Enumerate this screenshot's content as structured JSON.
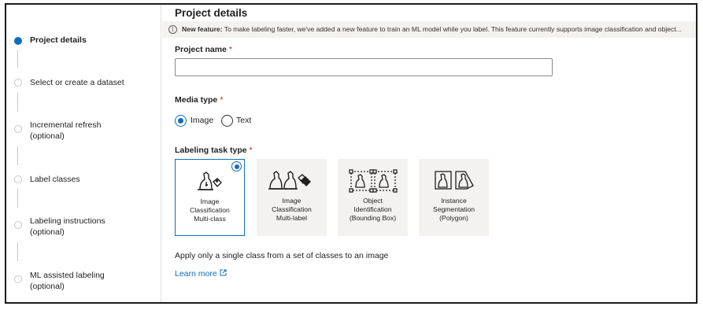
{
  "sidebar": {
    "steps": [
      {
        "label": "Project details",
        "active": true
      },
      {
        "label": "Select or create a dataset",
        "active": false
      },
      {
        "label": "Incremental refresh (optional)",
        "active": false
      },
      {
        "label": "Label classes",
        "active": false
      },
      {
        "label": "Labeling instructions (optional)",
        "active": false
      },
      {
        "label": "ML assisted labeling (optional)",
        "active": false
      }
    ]
  },
  "main": {
    "title": "Project details",
    "banner": {
      "bold": "New feature:",
      "text": " To make labeling faster, we've added a new feature to train an ML model while you label. This feature currently supports image classification and object..."
    },
    "project_name": {
      "label": "Project name",
      "required_mark": "*",
      "value": "",
      "placeholder": ""
    },
    "media_type": {
      "label": "Media type",
      "required_mark": "*",
      "options": [
        {
          "label": "Image",
          "selected": true
        },
        {
          "label": "Text",
          "selected": false
        }
      ]
    },
    "labeling_task": {
      "label": "Labeling task type",
      "required_mark": "*",
      "tiles": [
        {
          "line1": "Image",
          "line2": "Classification",
          "line3": "Multi-class",
          "selected": true,
          "icon": "dog-tag-icon"
        },
        {
          "line1": "Image",
          "line2": "Classification",
          "line3": "Multi-label",
          "selected": false,
          "icon": "two-dogs-tag-icon"
        },
        {
          "line1": "Object",
          "line2": "Identification",
          "line3": "(Bounding Box)",
          "selected": false,
          "icon": "bounding-box-icon"
        },
        {
          "line1": "Instance",
          "line2": "Segmentation",
          "line3": "(Polygon)",
          "selected": false,
          "icon": "polygon-icon"
        }
      ]
    },
    "description": "Apply only a single class from a set of classes to an image",
    "learn_more": "Learn more"
  },
  "colors": {
    "accent": "#0f6cbd",
    "required": "#a4262c",
    "banner_bg": "#f3f2f1"
  }
}
